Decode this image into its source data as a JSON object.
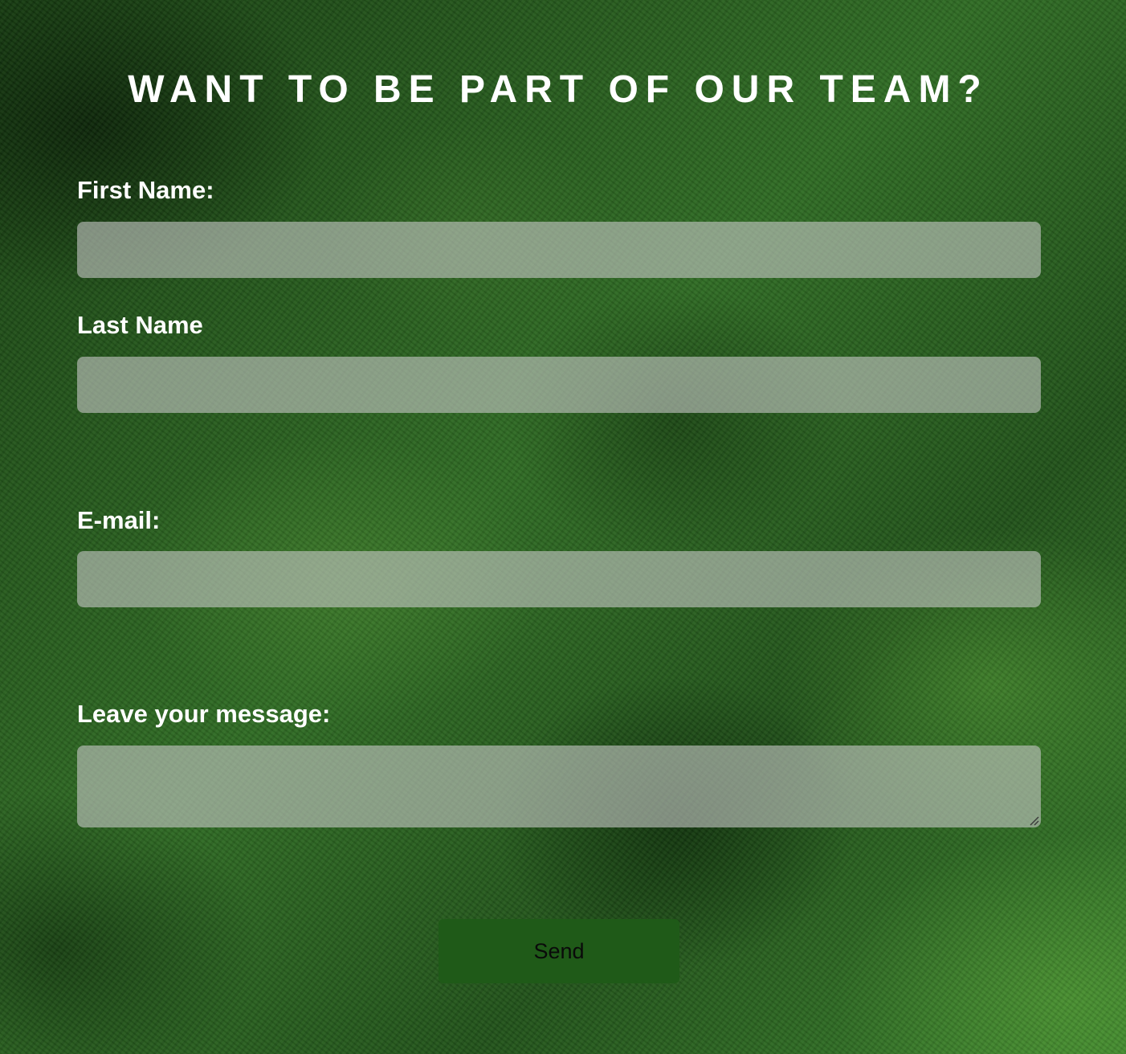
{
  "form": {
    "title": "WANT TO BE PART OF OUR TEAM?",
    "fields": [
      {
        "label": "First Name:",
        "value": "",
        "placeholder": ""
      },
      {
        "label": "Last Name",
        "value": "",
        "placeholder": ""
      },
      {
        "label": "E-mail:",
        "value": "",
        "placeholder": ""
      },
      {
        "label": "Leave your message:",
        "value": "",
        "placeholder": ""
      }
    ],
    "submit_label": "Send"
  },
  "colors": {
    "background": "#2f6a24",
    "text": "#ffffff",
    "input_background": "rgba(200,200,200,0.6)",
    "button_background": "#1f5a18",
    "button_text": "#0a0a0a"
  },
  "icons": {
    "textarea_resize": "resize-grip-icon"
  }
}
